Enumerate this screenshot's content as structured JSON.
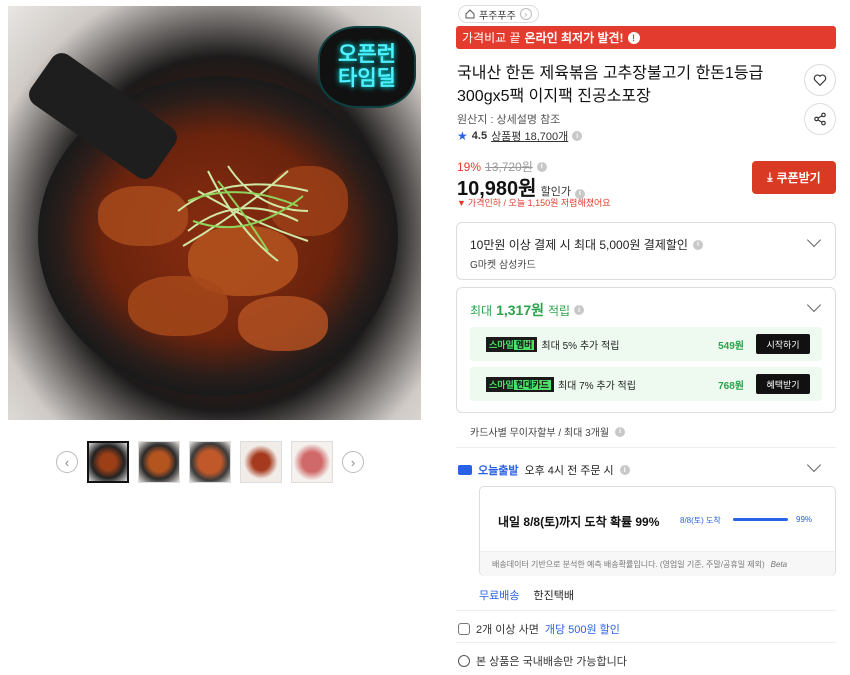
{
  "image_badge": {
    "line1": "오픈런",
    "line2": "타임딜"
  },
  "thumbnails": {
    "prev": "‹",
    "next": "›",
    "count": 5
  },
  "seller": {
    "name": "푸주푸주",
    "chevron": "›"
  },
  "promo": {
    "prefix": "가격비교 끝",
    "highlight": "온라인 최저가 발견!",
    "info": "!"
  },
  "product": {
    "title": "국내산 한돈 제육볶음 고추장불고기 한돈1등급 300gx5팩 이지팩 진공소포장",
    "origin": "원산지 : 상세설명 참조",
    "rating": "4.5",
    "reviews": "상품평 18,700개"
  },
  "price": {
    "discount_pct": "19%",
    "original": "13,720원",
    "final": "10,980원",
    "final_label": "할인가",
    "drop_note": "가격인하 / 오늘 1,150원 저렴해졌어요"
  },
  "coupon": {
    "label": "쿠폰받기"
  },
  "card_discount": {
    "title": "10만원 이상 결제 시 최대 5,000원 결제할인",
    "card": "G마켓 삼성카드"
  },
  "reward": {
    "prefix": "최대",
    "amount": "1,317원",
    "suffix": "적립",
    "rows": [
      {
        "tag_a": "스마일",
        "tag_b": "멤버",
        "text": "최대 5% 추가 적립",
        "amount": "549원",
        "button": "시작하기"
      },
      {
        "tag_a": "스마일",
        "tag_b": "현대카드",
        "text": "최대 7% 추가 적립",
        "amount": "768원",
        "button": "혜택받기"
      }
    ]
  },
  "installment": {
    "text": "카드사별 무이자할부 / 최대 3개월"
  },
  "delivery": {
    "brand": "오늘출발",
    "cutoff": "오후 4시 전 주문 시",
    "prob_text": "내일 8/8(토)까지 도착 확률 99%",
    "prob_date": "8/8(토) 도착",
    "prob_pct": "99%",
    "prob_value": 0.99,
    "footnote": "배송데이터 기반으로 분석한 예측 배송확률입니다. (영업일 기준, 주말/공휴일 제외)",
    "beta": "Beta",
    "shipping_fee": "무료배송",
    "courier": "한진택배"
  },
  "bulk": {
    "prefix": "2개 이상 사면",
    "highlight": "개당 500원 할인"
  },
  "domestic": {
    "text": "본 상품은 국내배송만 가능합니다"
  },
  "colors": {
    "accent_red": "#e33b2e",
    "accent_blue": "#2a62e6",
    "accent_green": "#2aa34a"
  }
}
